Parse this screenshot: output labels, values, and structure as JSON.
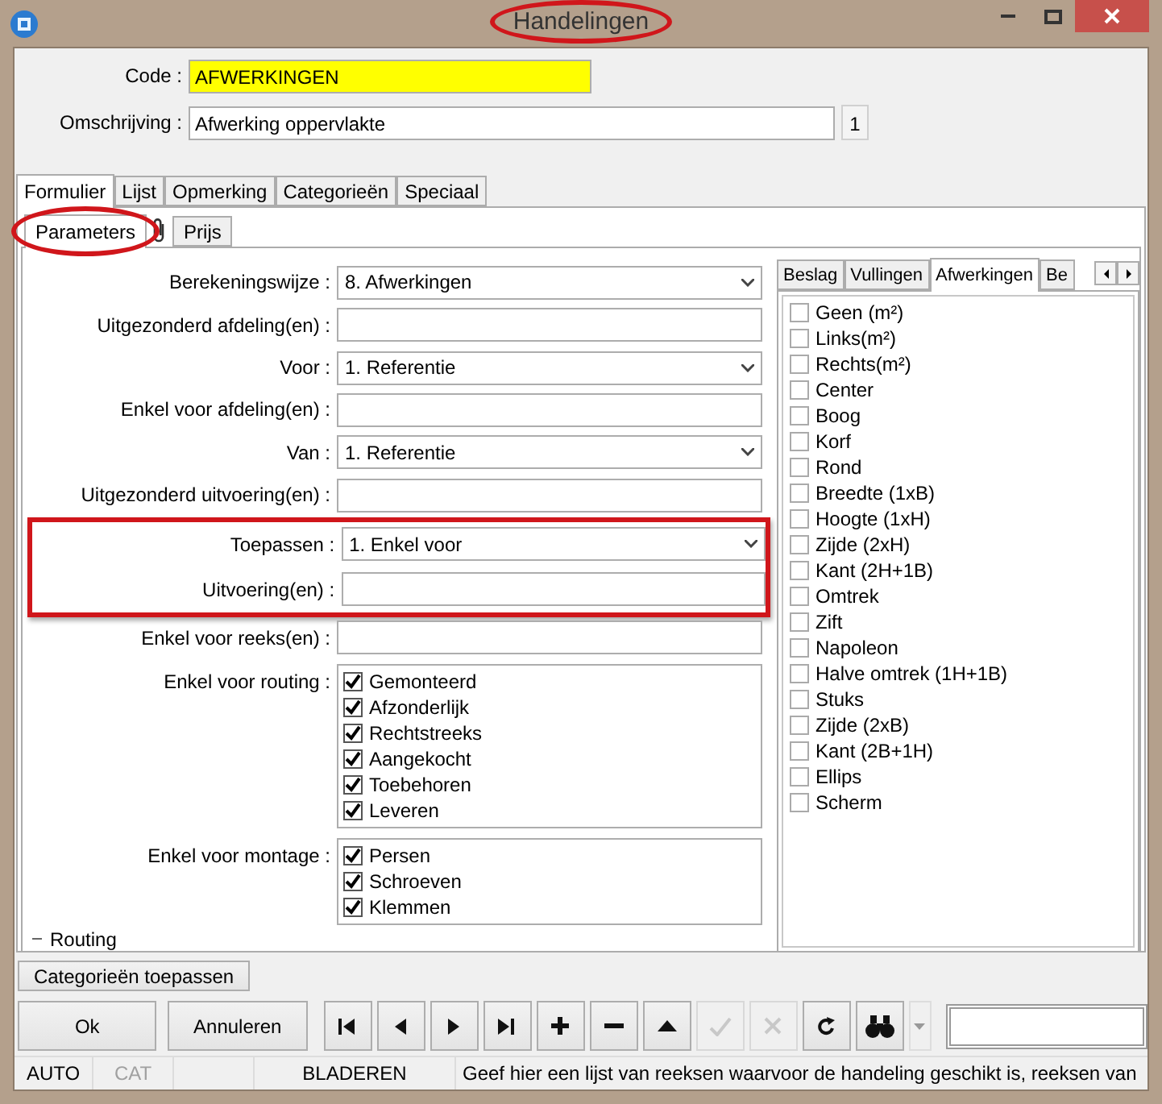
{
  "window": {
    "title": "Handelingen",
    "highlighted": true
  },
  "code": {
    "label": "Code :",
    "value": "AFWERKINGEN"
  },
  "description": {
    "label": "Omschrijving :",
    "value": "Afwerking oppervlakte",
    "counter": "1"
  },
  "tabs": [
    {
      "label": "Formulier",
      "selected": true
    },
    {
      "label": "Lijst",
      "selected": false
    },
    {
      "label": "Opmerking",
      "selected": false
    },
    {
      "label": "Categorieën",
      "selected": false
    },
    {
      "label": "Speciaal",
      "selected": false
    }
  ],
  "subtabs": [
    {
      "label": "Parameters",
      "selected": true,
      "highlighted": true
    },
    {
      "label": "Prijs",
      "selected": false,
      "highlighted": false
    }
  ],
  "form": {
    "fields": [
      {
        "kind": "select",
        "label": "Berekeningswijze :",
        "value": "8.  Afwerkingen",
        "highlighted": false
      },
      {
        "kind": "text",
        "label": "Uitgezonderd afdeling(en) :",
        "highlighted": false
      },
      {
        "kind": "select",
        "label": "Voor :",
        "value": "1.  Referentie",
        "highlighted": false
      },
      {
        "kind": "text",
        "label": "Enkel voor afdeling(en) :",
        "highlighted": false
      },
      {
        "kind": "select",
        "label": "Van :",
        "value": "1.  Referentie",
        "highlighted": false
      },
      {
        "kind": "text",
        "label": "Uitgezonderd uitvoering(en) :",
        "highlighted": false
      },
      {
        "kind": "select",
        "label": "Toepassen :",
        "value": "1.  Enkel voor",
        "highlighted": true
      },
      {
        "kind": "text",
        "label": "Uitvoering(en) :",
        "highlighted": true
      },
      {
        "kind": "text",
        "label": "Enkel voor reeks(en) :",
        "highlighted": false
      }
    ],
    "checkgroups": [
      {
        "label": "Enkel voor routing :",
        "items": [
          {
            "label": "Gemonteerd",
            "checked": true
          },
          {
            "label": "Afzonderlijk",
            "checked": true
          },
          {
            "label": "Rechtstreeks",
            "checked": true
          },
          {
            "label": "Aangekocht",
            "checked": true
          },
          {
            "label": "Toebehoren",
            "checked": true
          },
          {
            "label": "Leveren",
            "checked": true
          }
        ]
      },
      {
        "label": "Enkel voor montage :",
        "items": [
          {
            "label": "Persen",
            "checked": true
          },
          {
            "label": "Schroeven",
            "checked": true
          },
          {
            "label": "Klemmen",
            "checked": true
          }
        ]
      }
    ],
    "section": "Routing"
  },
  "side_tabs": [
    {
      "label": "Beslag",
      "selected": false
    },
    {
      "label": "Vullingen",
      "selected": false
    },
    {
      "label": "Afwerkingen",
      "selected": true
    },
    {
      "label": "Be",
      "selected": false
    }
  ],
  "side_items": [
    {
      "label": "Geen (m²)",
      "checked": false
    },
    {
      "label": "Links(m²)",
      "checked": false
    },
    {
      "label": "Rechts(m²)",
      "checked": false
    },
    {
      "label": "Center",
      "checked": false
    },
    {
      "label": "Boog",
      "checked": false
    },
    {
      "label": "Korf",
      "checked": false
    },
    {
      "label": "Rond",
      "checked": false
    },
    {
      "label": "Breedte (1xB)",
      "checked": false
    },
    {
      "label": "Hoogte (1xH)",
      "checked": false
    },
    {
      "label": "Zijde (2xH)",
      "checked": false
    },
    {
      "label": "Kant (2H+1B)",
      "checked": false
    },
    {
      "label": "Omtrek",
      "checked": false
    },
    {
      "label": "Zift",
      "checked": false
    },
    {
      "label": "Napoleon",
      "checked": false
    },
    {
      "label": "Halve omtrek (1H+1B)",
      "checked": false
    },
    {
      "label": "Stuks",
      "checked": false
    },
    {
      "label": "Zijde (2xB)",
      "checked": false
    },
    {
      "label": "Kant (2B+1H)",
      "checked": false
    },
    {
      "label": "Ellips",
      "checked": false
    },
    {
      "label": "Scherm",
      "checked": false
    }
  ],
  "apply_button": "Categorieën toepassen",
  "buttons": [
    {
      "label": "Ok"
    },
    {
      "label": "Annuleren"
    }
  ],
  "nav": [
    {
      "kind": "first",
      "disabled": false
    },
    {
      "kind": "prev",
      "disabled": false
    },
    {
      "kind": "next",
      "disabled": false
    },
    {
      "kind": "last",
      "disabled": false
    },
    {
      "kind": "add",
      "disabled": false
    },
    {
      "kind": "remove",
      "disabled": false
    },
    {
      "kind": "up",
      "disabled": false
    },
    {
      "kind": "confirm",
      "disabled": true
    },
    {
      "kind": "discard",
      "disabled": true
    },
    {
      "kind": "refresh",
      "disabled": false
    },
    {
      "kind": "find",
      "disabled": false
    }
  ],
  "status_bar": {
    "cells": [
      {
        "kind": "text",
        "text": "AUTO",
        "disabled": false
      },
      {
        "kind": "text",
        "text": "CAT",
        "disabled": true
      },
      {
        "kind": "blank"
      },
      {
        "kind": "text",
        "text": "BLADEREN",
        "disabled": false
      }
    ],
    "message": "Geef hier een lijst van reeksen waarvoor de handeling geschikt is, reeksen van"
  }
}
